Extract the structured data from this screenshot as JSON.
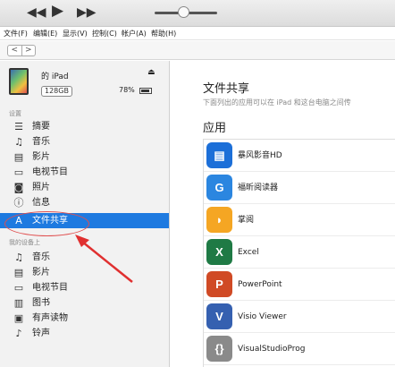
{
  "toolbar": {
    "rewind_icon": "rewind-icon",
    "play_icon": "play-icon",
    "forward_icon": "fast-forward-icon",
    "volume_level": 0.45
  },
  "menubar": {
    "items": [
      "文件(F)",
      "编辑(E)",
      "显示(V)",
      "控制(C)",
      "帐户(A)",
      "帮助(H)"
    ]
  },
  "nav": {
    "back": "<",
    "forward": ">"
  },
  "device": {
    "name": "的 iPad",
    "capacity": "128GB",
    "battery": "78%"
  },
  "sidebar": {
    "settings_label": "设置",
    "settings_items": [
      {
        "label": "摘要",
        "icon": "summary-icon"
      },
      {
        "label": "音乐",
        "icon": "music-note-icon"
      },
      {
        "label": "影片",
        "icon": "film-icon"
      },
      {
        "label": "电视节目",
        "icon": "tv-icon"
      },
      {
        "label": "照片",
        "icon": "camera-icon"
      },
      {
        "label": "信息",
        "icon": "info-icon"
      },
      {
        "label": "文件共享",
        "icon": "app-store-icon"
      }
    ],
    "ondevice_label": "我的设备上",
    "ondevice_items": [
      {
        "label": "音乐",
        "icon": "music-note-icon"
      },
      {
        "label": "影片",
        "icon": "film-icon"
      },
      {
        "label": "电视节目",
        "icon": "tv-icon"
      },
      {
        "label": "图书",
        "icon": "book-icon"
      },
      {
        "label": "有声读物",
        "icon": "audiobook-icon"
      },
      {
        "label": "铃声",
        "icon": "bell-icon"
      }
    ]
  },
  "main": {
    "title": "文件共享",
    "description": "下面列出的应用可以在 iPad 和这台电脑之间传",
    "apps_heading": "应用",
    "apps": [
      {
        "name": "暴风影音HD",
        "color": "#1c6fd8",
        "glyph": "▤"
      },
      {
        "name": "福昕阅读器",
        "color": "#2b86e0",
        "glyph": "G"
      },
      {
        "name": "掌阅",
        "color": "#f5a623",
        "glyph": "◗"
      },
      {
        "name": "Excel",
        "color": "#1f7a45",
        "glyph": "X"
      },
      {
        "name": "PowerPoint",
        "color": "#d04a25",
        "glyph": "P"
      },
      {
        "name": "Visio Viewer",
        "color": "#3560b0",
        "glyph": "V"
      },
      {
        "name": "VisualStudioProg",
        "color": "#8a8a8a",
        "glyph": "{}"
      }
    ]
  }
}
